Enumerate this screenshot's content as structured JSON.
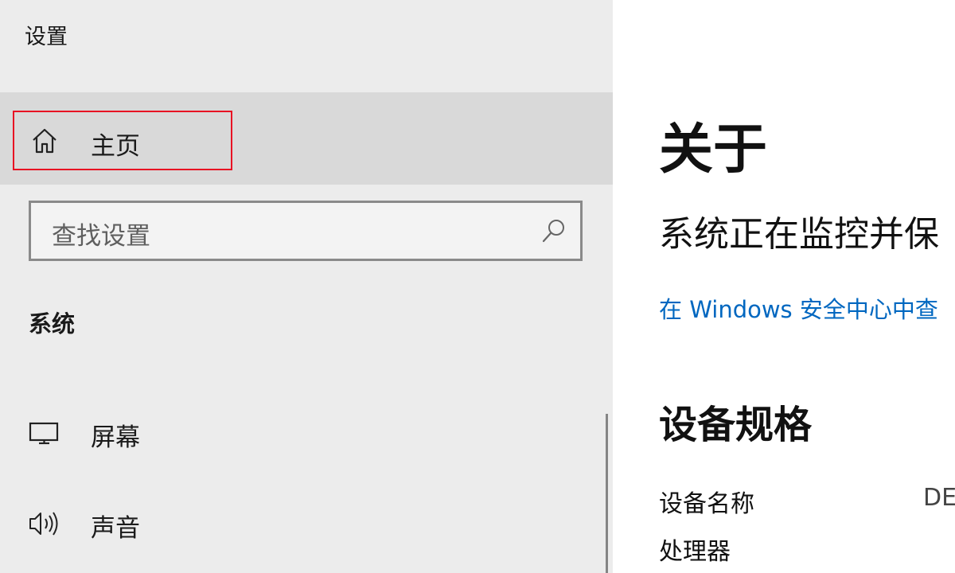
{
  "window": {
    "app_title": "设置"
  },
  "sidebar": {
    "home": {
      "label": "主页",
      "icon": "home-icon"
    },
    "search": {
      "placeholder": "查找设置",
      "icon": "search-icon"
    },
    "section_title": "系统",
    "items": [
      {
        "label": "屏幕",
        "icon": "display-icon"
      },
      {
        "label": "声音",
        "icon": "speaker-icon"
      }
    ]
  },
  "main": {
    "title": "关于",
    "protection_status": "系统正在监控并保",
    "security_link": "在 Windows 安全中心中查",
    "specs": {
      "title": "设备规格",
      "rows": [
        {
          "label": "设备名称",
          "value": "DE"
        },
        {
          "label": "处理器",
          "value": ""
        }
      ]
    }
  },
  "colors": {
    "highlight_border": "#e81123",
    "link": "#0067c0",
    "selected_row": "#d9d9d9"
  }
}
